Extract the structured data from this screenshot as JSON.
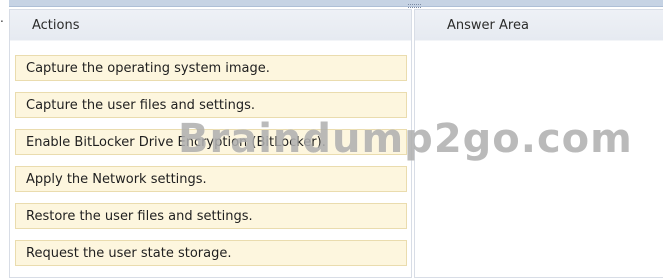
{
  "left_marker": ".",
  "actions_panel": {
    "title": "Actions",
    "items": [
      {
        "label": "Capture the operating system image."
      },
      {
        "label": "Capture the user files and settings."
      },
      {
        "label": "Enable BitLocker Drive Encryption (BitLocker)."
      },
      {
        "label": "Apply the Network settings."
      },
      {
        "label": "Restore the user files and settings."
      },
      {
        "label": "Request the user state storage."
      }
    ]
  },
  "answer_panel": {
    "title": "Answer Area"
  },
  "watermark": "Braindump2go.com",
  "colors": {
    "item_background": "#fdf6de",
    "item_border": "#eadcae",
    "header_background": "#e6eaf1"
  }
}
